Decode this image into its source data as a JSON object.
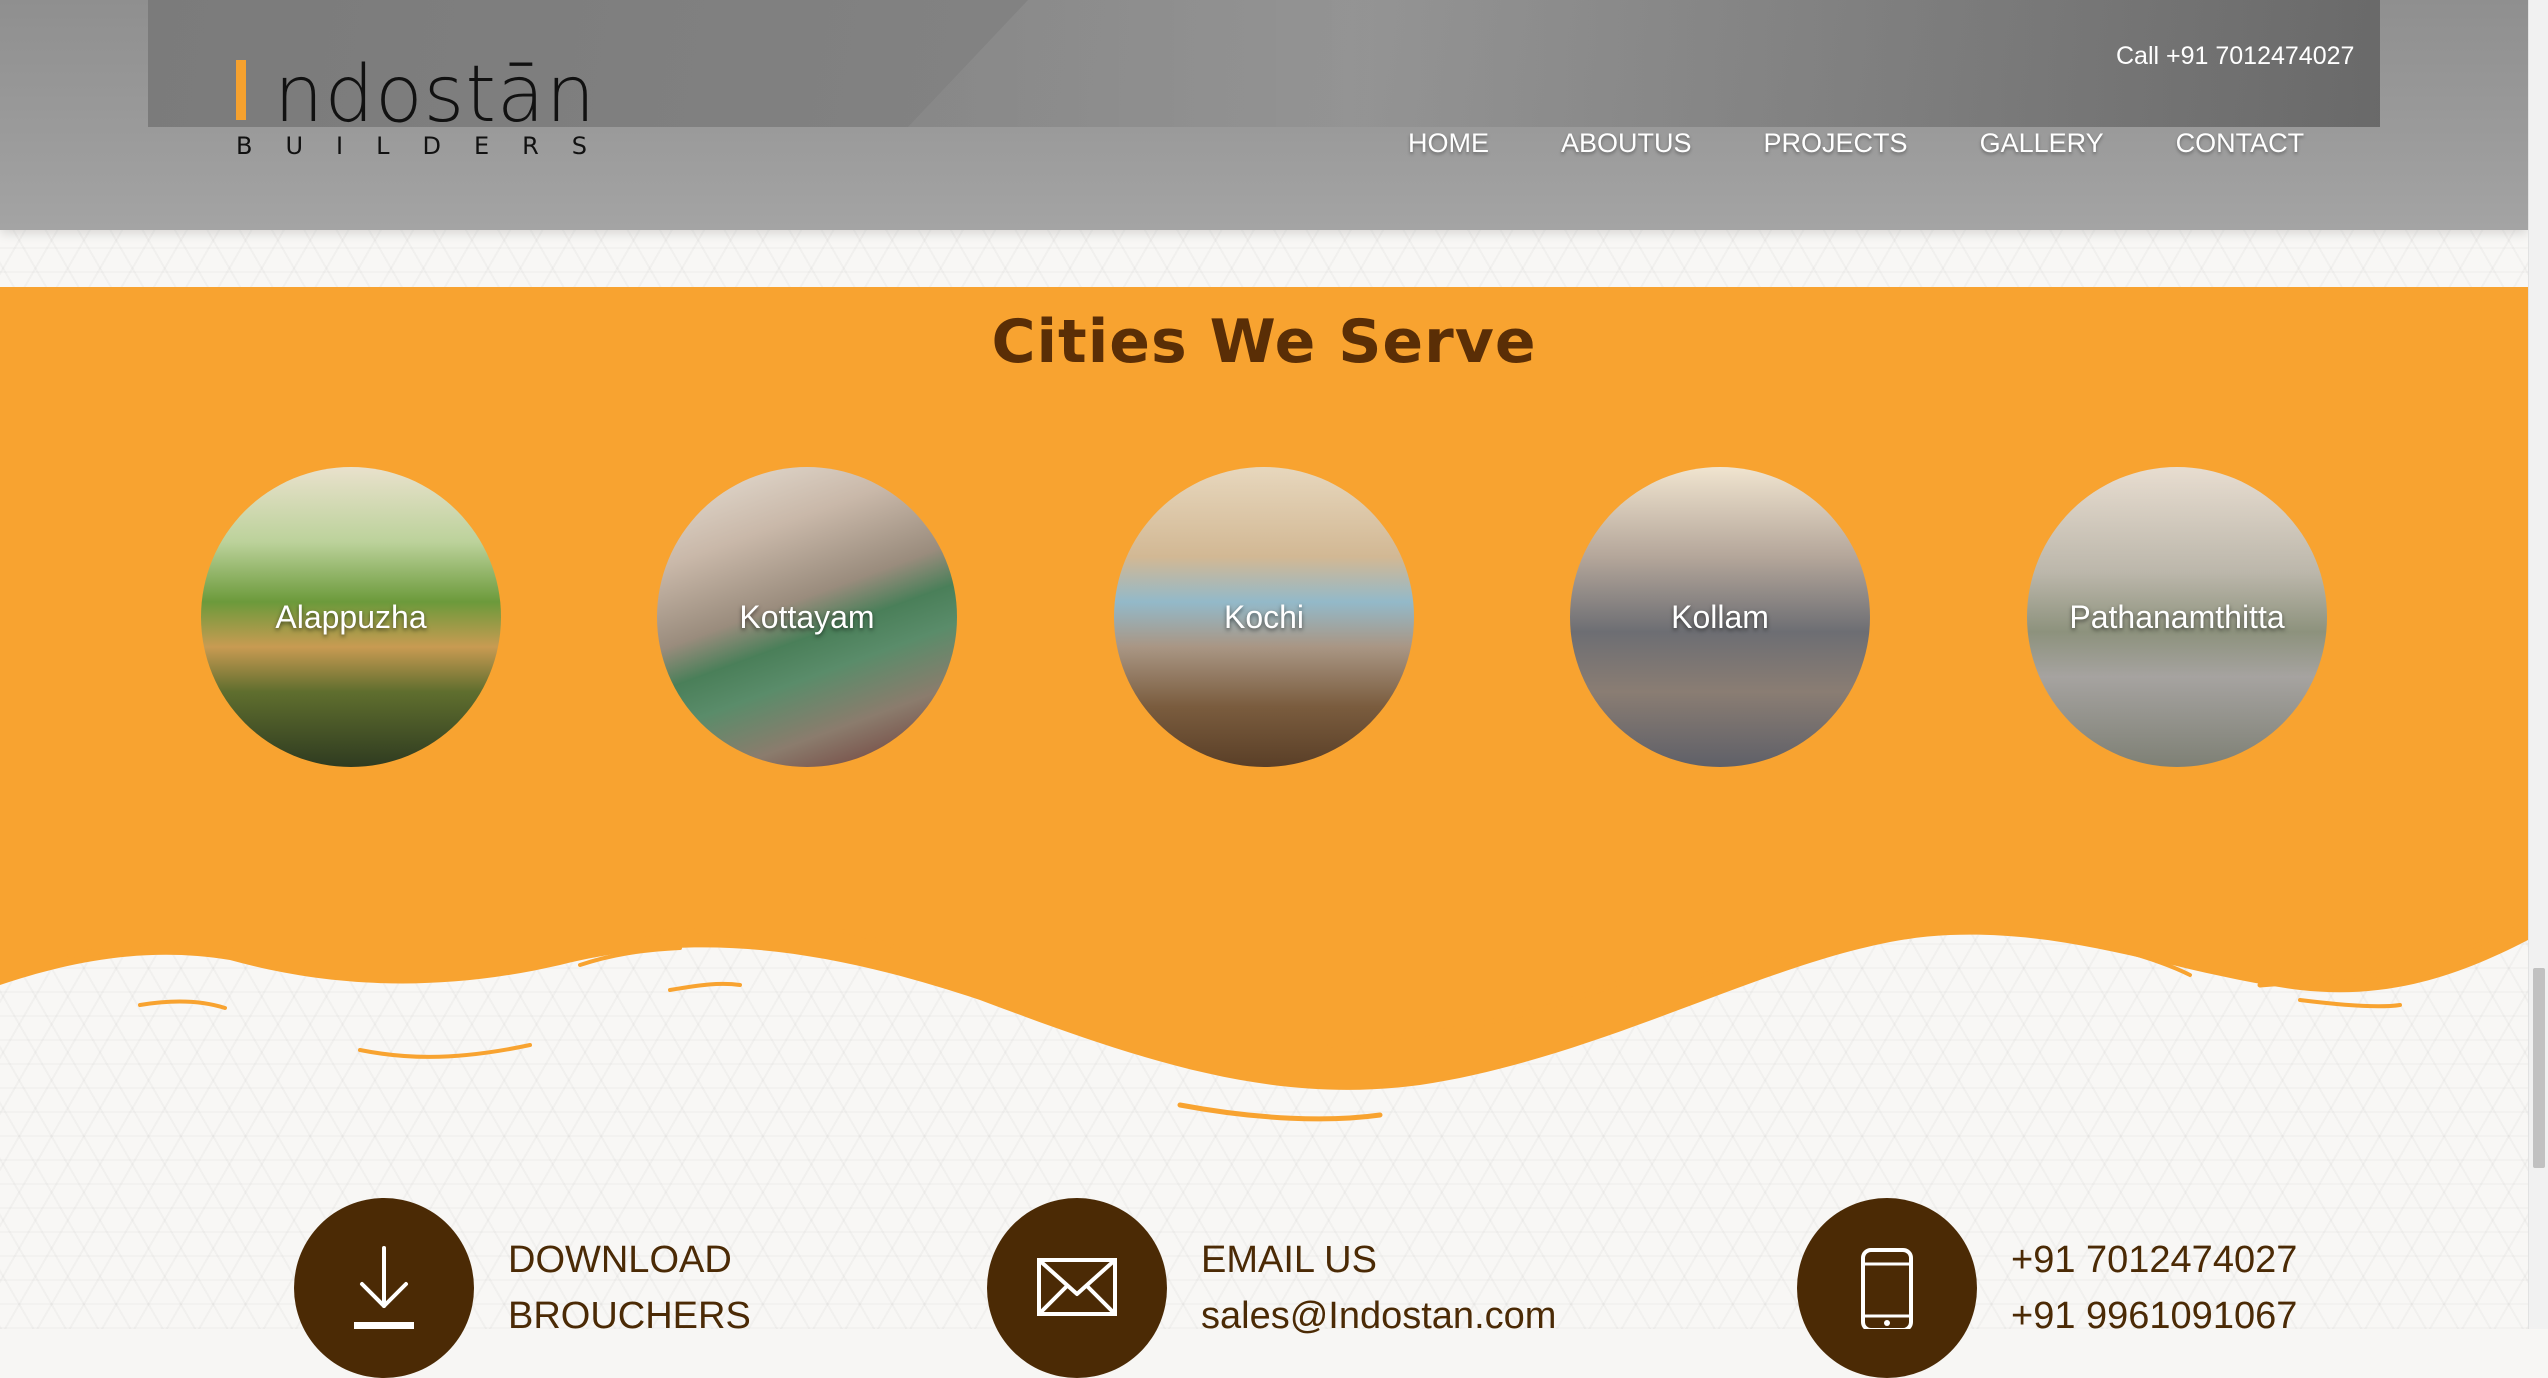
{
  "brand": {
    "name_first_letter": "I",
    "name_rest": "ndostān",
    "tagline": "BUILDERS",
    "accent_color": "#f6a12e"
  },
  "header": {
    "call_text": "Call +91 7012474027"
  },
  "nav": {
    "items": [
      {
        "label": "HOME"
      },
      {
        "label": "ABOUTUS"
      },
      {
        "label": "PROJECTS"
      },
      {
        "label": "GALLERY"
      },
      {
        "label": "CONTACT"
      }
    ]
  },
  "cities": {
    "title": "Cities We Serve",
    "background_color": "#f8a330",
    "items": [
      {
        "name": "Alappuzha"
      },
      {
        "name": "Kottayam"
      },
      {
        "name": "Kochi"
      },
      {
        "name": "Kollam"
      },
      {
        "name": "Pathanamthitta"
      }
    ]
  },
  "contact": {
    "download": {
      "line1": "DOWNLOAD",
      "line2": "BROUCHERS",
      "icon": "download-icon"
    },
    "email": {
      "title": "EMAIL US",
      "address": "sales@Indostan.com",
      "icon": "envelope-icon"
    },
    "phone": {
      "number1": "+91 7012474027",
      "number2": "+91 9961091067",
      "icon": "mobile-phone-icon"
    },
    "circle_color": "#4b2a05"
  }
}
